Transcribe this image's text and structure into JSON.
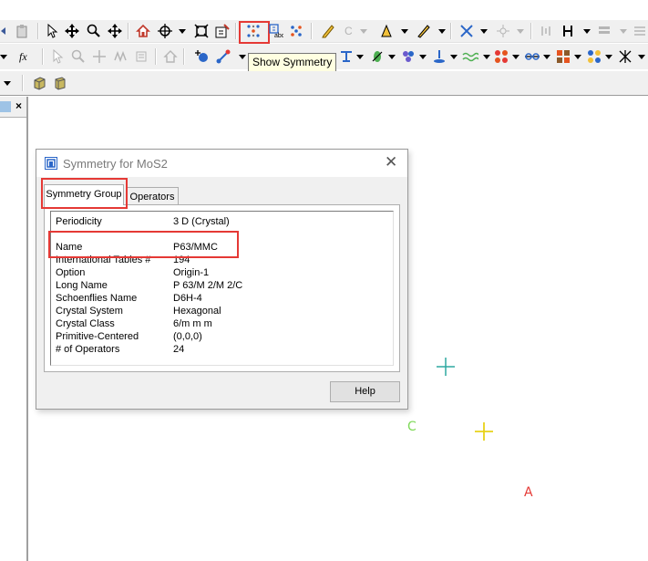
{
  "tooltip": {
    "text": "Show Symmetry"
  },
  "dialog": {
    "title": "Symmetry for MoS2",
    "tabs": [
      {
        "label": "Symmetry Group",
        "selected": true
      },
      {
        "label": "Operators",
        "selected": false
      }
    ],
    "properties": [
      {
        "key": "Periodicity",
        "value": "3 D (Crystal)"
      },
      {
        "key": "Name",
        "value": "P63/MMC"
      },
      {
        "key": "International Tables #",
        "value": "194"
      },
      {
        "key": "Option",
        "value": "Origin-1"
      },
      {
        "key": "Long Name",
        "value": "P 63/M 2/M 2/C"
      },
      {
        "key": "Schoenflies Name",
        "value": "D6H-4"
      },
      {
        "key": "Crystal System",
        "value": "Hexagonal"
      },
      {
        "key": "Crystal Class",
        "value": "6/m m m"
      },
      {
        "key": "Primitive-Centered",
        "value": "(0,0,0)"
      },
      {
        "key": "# of Operators",
        "value": "24"
      }
    ],
    "help_label": "Help"
  },
  "canvas": {
    "labels": {
      "c": "C",
      "a": "A"
    },
    "colors": {
      "c_label": "#7ed957",
      "a_label": "#e53935",
      "cross_cyan": "#2ea8a0",
      "cross_yellow": "#e8d21a"
    }
  },
  "left_panel": {
    "close_glyph": "×"
  },
  "toolbar": {
    "icons_row1": [
      "undo-icon",
      "paste-icon",
      "select-arrow-icon",
      "move-icon",
      "zoom-icon",
      "translate-icon",
      "home-icon",
      "center-icon",
      "fit-icon",
      "properties-icon",
      "show-symmetry-icon",
      "cell-abc-icon",
      "symmetry-atoms-icon",
      "pencil-icon",
      "carbon-icon",
      "draw-ring-icon",
      "draw-bond-icon",
      "bond-type-icon",
      "fragment-icon",
      "hydrogen-icon",
      "stack-icon",
      "more-icon"
    ],
    "icons_row2": [
      "fx-icon",
      "select-icon",
      "zoom2-icon",
      "move2-icon",
      "rotate-icon",
      "translate2-icon",
      "home2-icon",
      "add-atom-icon",
      "add-bond-icon",
      "measure-icon",
      "align-icon",
      "cluster-icon",
      "filter-icon",
      "wave-icon",
      "ring-icon",
      "link-icon",
      "grid-icon",
      "balls-icon",
      "cross-icon"
    ],
    "icons_row3": [
      "build-crystal-icon",
      "cell-icon"
    ]
  }
}
